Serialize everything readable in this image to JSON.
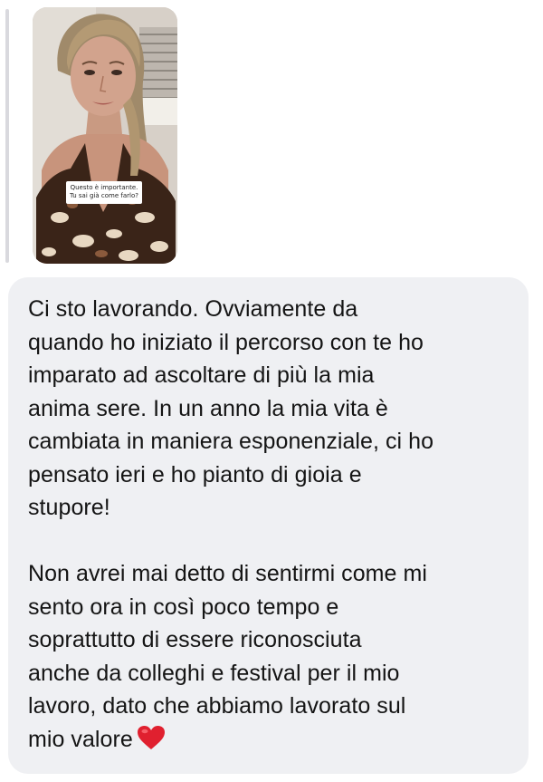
{
  "story_reply": {
    "sticker_line1": "Questo è importante.",
    "sticker_line2": "Tu sai già come farlo?"
  },
  "message": {
    "paragraph1": [
      "Ci sto lavorando. Ovviamente da",
      "quando ho iniziato il percorso con te ho",
      "imparato ad ascoltare di più la mia",
      "anima sere. In un anno la mia vita è",
      "cambiata in maniera esponenziale, ci ho",
      "pensato ieri e ho pianto di gioia e",
      "stupore!"
    ],
    "paragraph2": [
      "Non avrei mai detto di sentirmi come mi",
      "sento ora in così poco tempo e",
      "soprattutto di essere riconosciuta",
      "anche da colleghi e festival per il mio",
      "lavoro, dato che abbiamo lavorato sul",
      "mio valore"
    ],
    "emoji": "heart-icon"
  },
  "colors": {
    "bubble_background": "#eff0f3",
    "text": "#141414",
    "heart": "#e0202f"
  }
}
